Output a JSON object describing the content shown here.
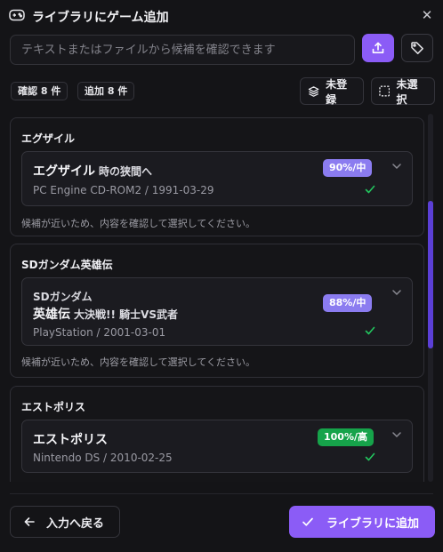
{
  "dialog": {
    "title": "ライブラリにゲーム追加",
    "title_icon": "gamepad-icon",
    "close_icon": "close-icon"
  },
  "search": {
    "placeholder": "テキストまたはファイルから候補を確認できます",
    "upload_icon": "upload-icon",
    "tag_icon": "tag-icon"
  },
  "summary": {
    "confirm_label": "確認 8 件",
    "add_label": "追加 8 件"
  },
  "filters": {
    "unregistered": {
      "label": "未登録",
      "icon": "stack-icon"
    },
    "unselected": {
      "label": "未選択",
      "icon": "dashed-square-icon"
    }
  },
  "groups": [
    {
      "title": "エグザイル",
      "candidate": {
        "name": "エグザイル",
        "subtitle": "時の狭間へ",
        "platform_date": "PC Engine CD-ROM2 / 1991-03-29",
        "badge": "90%/中",
        "confidence": "mid"
      },
      "note": "候補が近いため、内容を確認して選択してください。"
    },
    {
      "title": "SDガンダム英雄伝",
      "candidate": {
        "prefix": "SDガンダム",
        "name": "英雄伝",
        "subtitle": "大決戦!! 騎士VS武者",
        "platform_date": "PlayStation / 2001-03-01",
        "badge": "88%/中",
        "confidence": "mid"
      },
      "note": "候補が近いため、内容を確認して選択してください。"
    },
    {
      "title": "エストポリス",
      "candidate": {
        "name": "エストポリス",
        "platform_date": "Nintendo DS / 2010-02-25",
        "badge": "100%/高",
        "confidence": "high"
      }
    }
  ],
  "footer": {
    "back_label": "入力へ戻る",
    "add_label": "ライブラリに追加"
  },
  "colors": {
    "accent": "#8b5cf6",
    "badge_mid": "#8b7cf0",
    "badge_high": "#16a34a",
    "check": "#22c55e"
  }
}
